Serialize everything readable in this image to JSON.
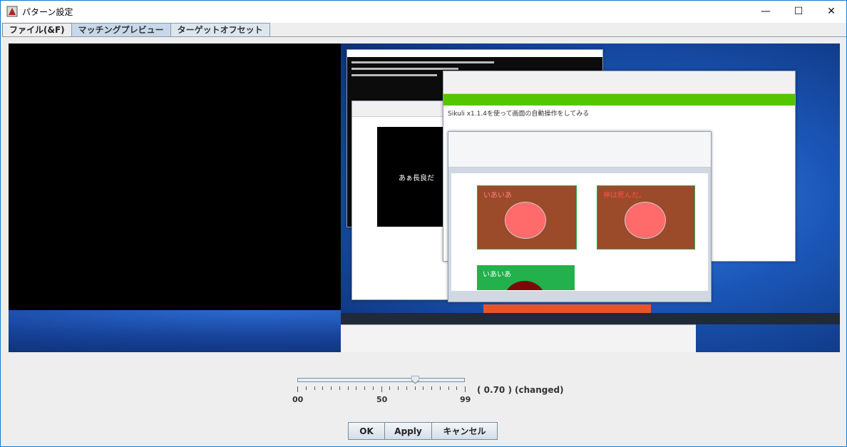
{
  "window": {
    "title": "パターン設定",
    "min_glyph": "—",
    "max_glyph": "☐",
    "close_glyph": "✕"
  },
  "tabs": [
    {
      "label": "ファイル(&F)"
    },
    {
      "label": "マッチングプレビュー"
    },
    {
      "label": "ターゲットオフセット"
    }
  ],
  "slider": {
    "tick_labels": [
      "00",
      "50",
      "99"
    ],
    "value_text": "( 0.70 )",
    "status_text": "(changed)",
    "value": 0.7
  },
  "buttons": {
    "ok": "OK",
    "apply": "Apply",
    "cancel": "キャンセル"
  },
  "preview": {
    "jp_text_1": "あぁ長良だ",
    "qiita_title": "Sikuli x1.1.4を使って画面の自動操作をしてみる",
    "box1_text": "いあいあ",
    "box2_text": "神は死んだ。",
    "box3_text": "いあいあ"
  },
  "colors": {
    "accent": "#1979ca",
    "qiita_green": "#55c500",
    "box_brown": "#9b4a2a",
    "box_green": "#22b14c",
    "circle_pink": "#ff6b6b"
  }
}
